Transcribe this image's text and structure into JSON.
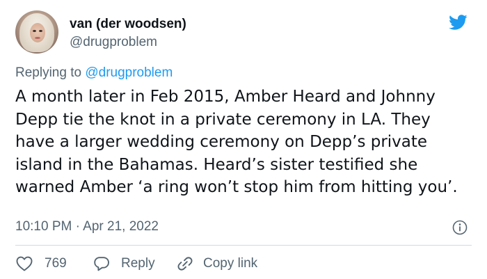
{
  "author": {
    "display_name": "van (der woodsen)",
    "handle": "@drugproblem",
    "avatar_icon": "profile-photo"
  },
  "reply_context": {
    "prefix": "Replying to",
    "mention": "@drugproblem"
  },
  "tweet": {
    "text": "A month later in Feb 2015, Amber Heard and Johnny Depp tie the knot in a private ceremony in LA. They have a larger wedding ceremony on Depp’s private island in the Bahamas. Heard’s sister testified she warned Amber ‘a ring won’t stop him from hitting you’.",
    "timestamp": "10:10 PM · Apr 21, 2022"
  },
  "actions": {
    "like_count": "769",
    "reply_label": "Reply",
    "copy_link_label": "Copy link"
  },
  "icons": {
    "brand": "twitter-bird-icon",
    "info": "info-icon",
    "like": "heart-icon",
    "reply": "speech-bubble-icon",
    "copy": "link-icon"
  },
  "colors": {
    "brand_blue": "#1d9bf0",
    "text_primary": "#0f1419",
    "text_secondary": "#536471",
    "divider": "#cfd9de"
  }
}
